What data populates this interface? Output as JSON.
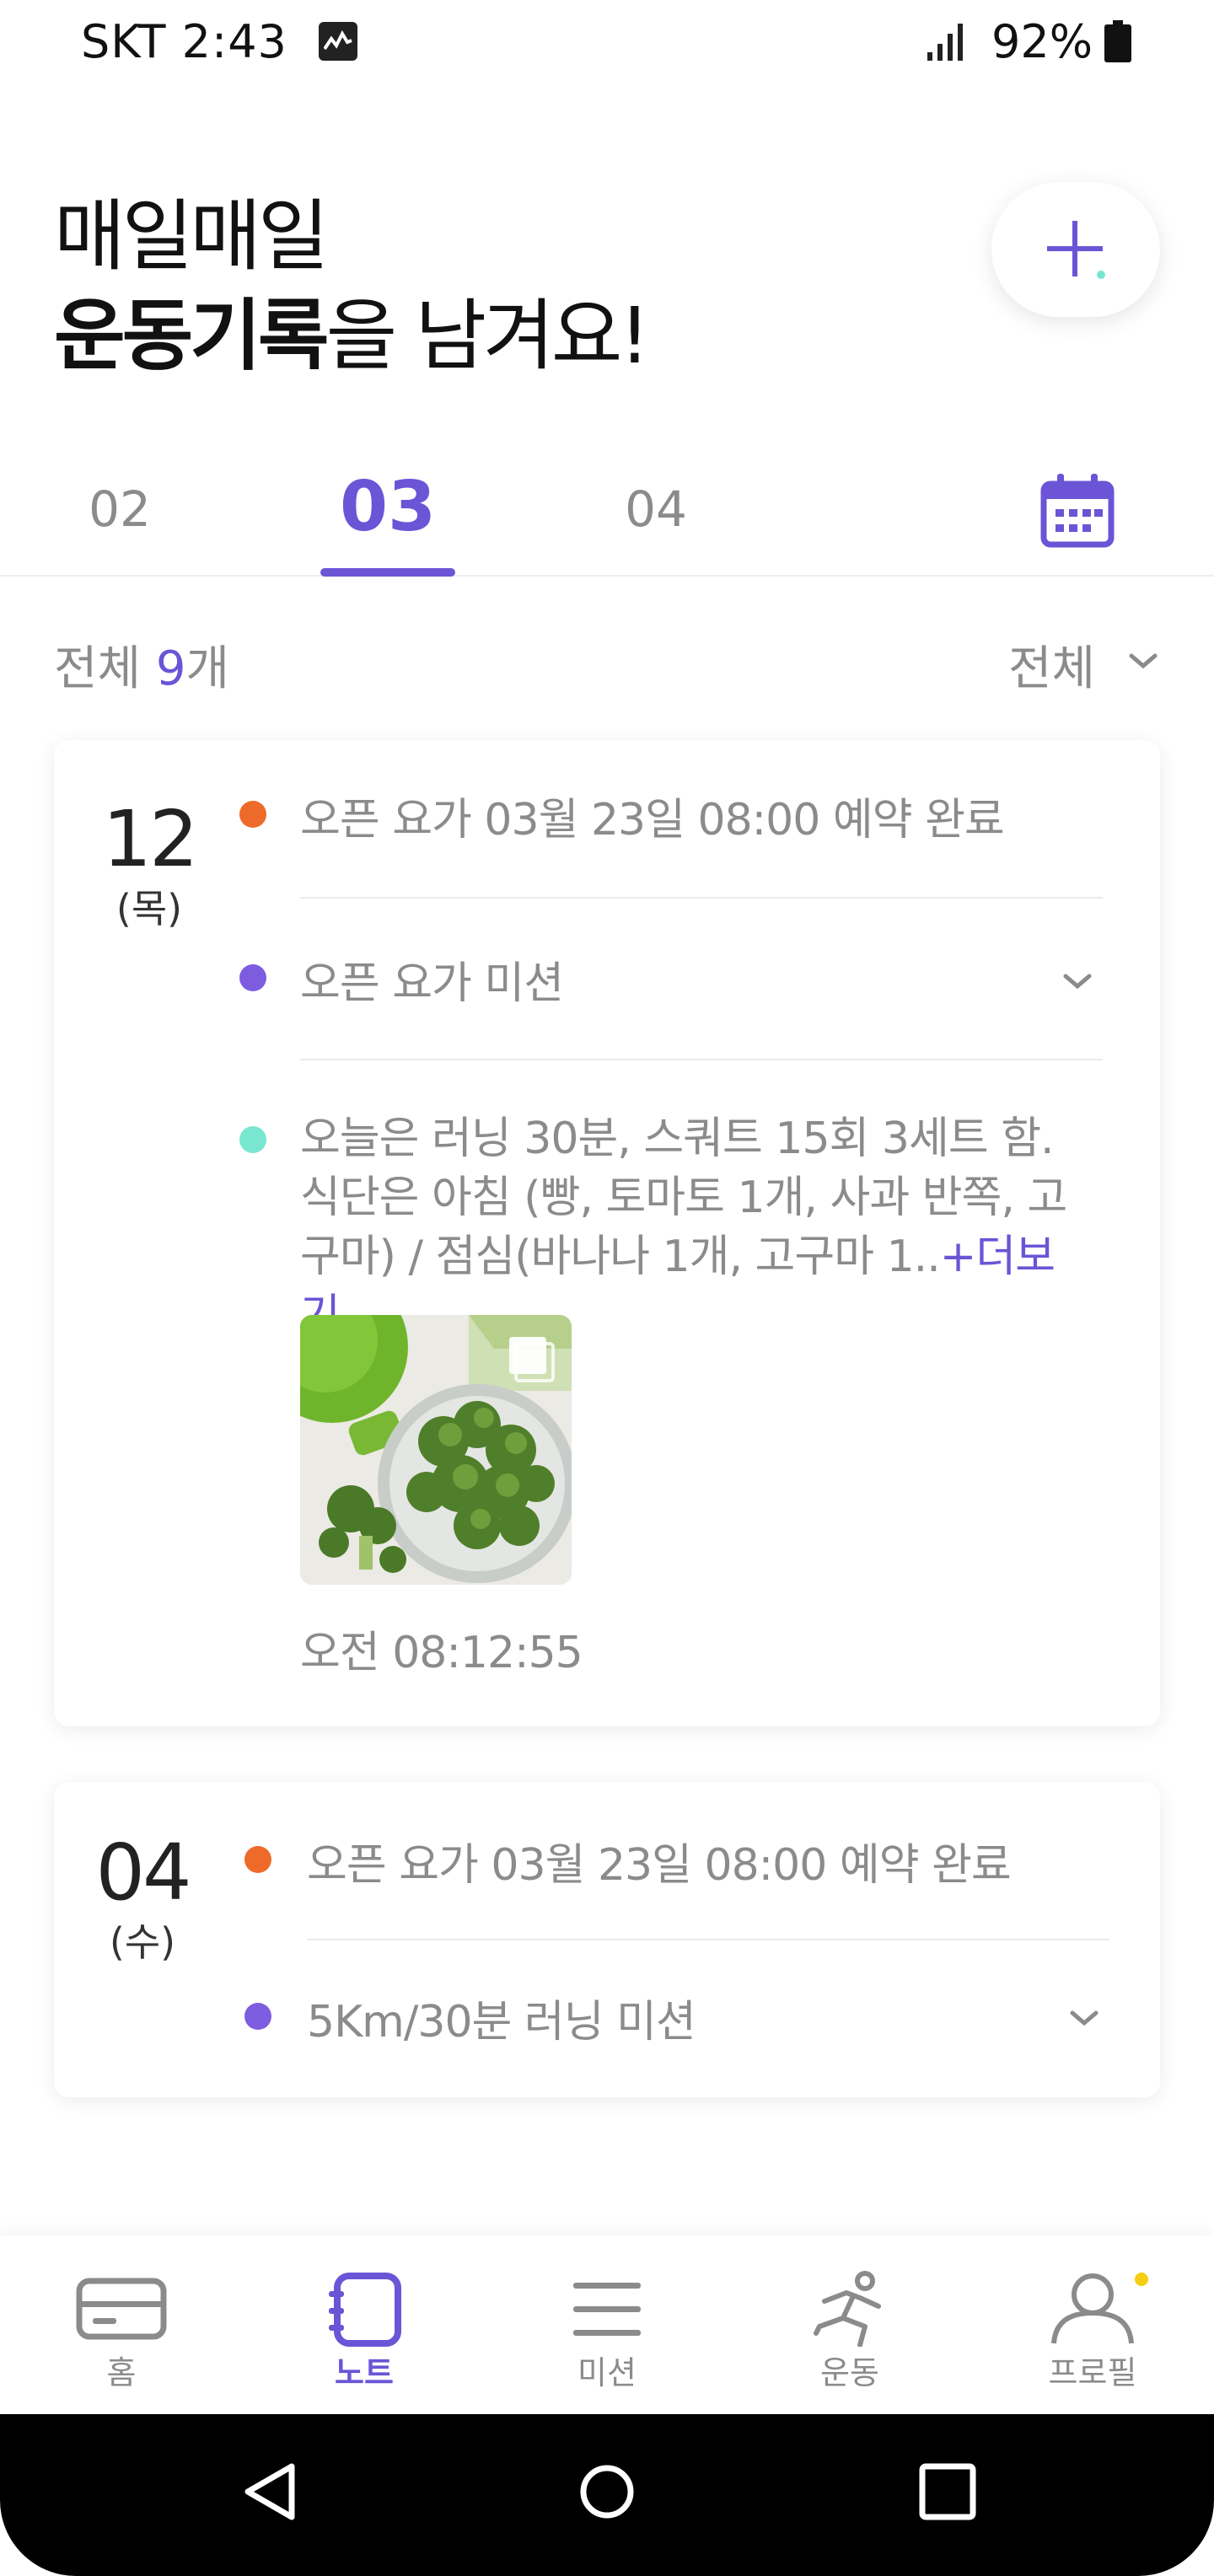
{
  "status_bar": {
    "carrier_time": "SKT 2:43",
    "battery": "92%"
  },
  "header": {
    "line1": "매일매일",
    "line2_bold": "운동기록",
    "line2_rest": "을 남겨요!"
  },
  "month_tabs": [
    {
      "label": "02",
      "selected": false
    },
    {
      "label": "03",
      "selected": true
    },
    {
      "label": "04",
      "selected": false
    }
  ],
  "filter": {
    "summary_prefix": "전체",
    "summary_count": "9",
    "summary_suffix": "개",
    "select_value": "전체"
  },
  "entries": [
    {
      "date": "12",
      "weekday": "(목)",
      "items": [
        {
          "dot_color": "#ee6a2a",
          "text": "오픈 요가 03월 23일 08:00 예약 완료"
        },
        {
          "dot_color": "#7d5ce0",
          "text": "오픈 요가 미션"
        },
        {
          "dot_color": "#79e6d0",
          "text": "오늘은 러닝 30분, 스쿼트 15회 3세트 함. 식단은 아침 (빵, 토마토 1개, 사과 반쪽, 고구마) / 점심(바나나 1개, 고구마 1..",
          "more": "+더보기"
        }
      ],
      "time": "오전 08:12:55"
    },
    {
      "date": "04",
      "weekday": "(수)",
      "items": [
        {
          "dot_color": "#ee6a2a",
          "text": "오픈 요가 03월 23일 08:00 예약 완료"
        },
        {
          "dot_color": "#7d5ce0",
          "text": "5Km/30분 러닝 미션"
        }
      ]
    }
  ],
  "bottom_nav": [
    {
      "label": "홈",
      "icon": "card-icon",
      "active": false
    },
    {
      "label": "노트",
      "icon": "note-icon",
      "active": true
    },
    {
      "label": "미션",
      "icon": "menu-icon",
      "active": false
    },
    {
      "label": "운동",
      "icon": "running-icon",
      "active": false
    },
    {
      "label": "프로필",
      "icon": "profile-icon",
      "active": false
    }
  ],
  "colors": {
    "accent": "#6b55d6",
    "orange_dot": "#ee6a2a",
    "purple_dot": "#7d5ce0",
    "mint_dot": "#79e6d0",
    "badge": "#f4cf12"
  }
}
